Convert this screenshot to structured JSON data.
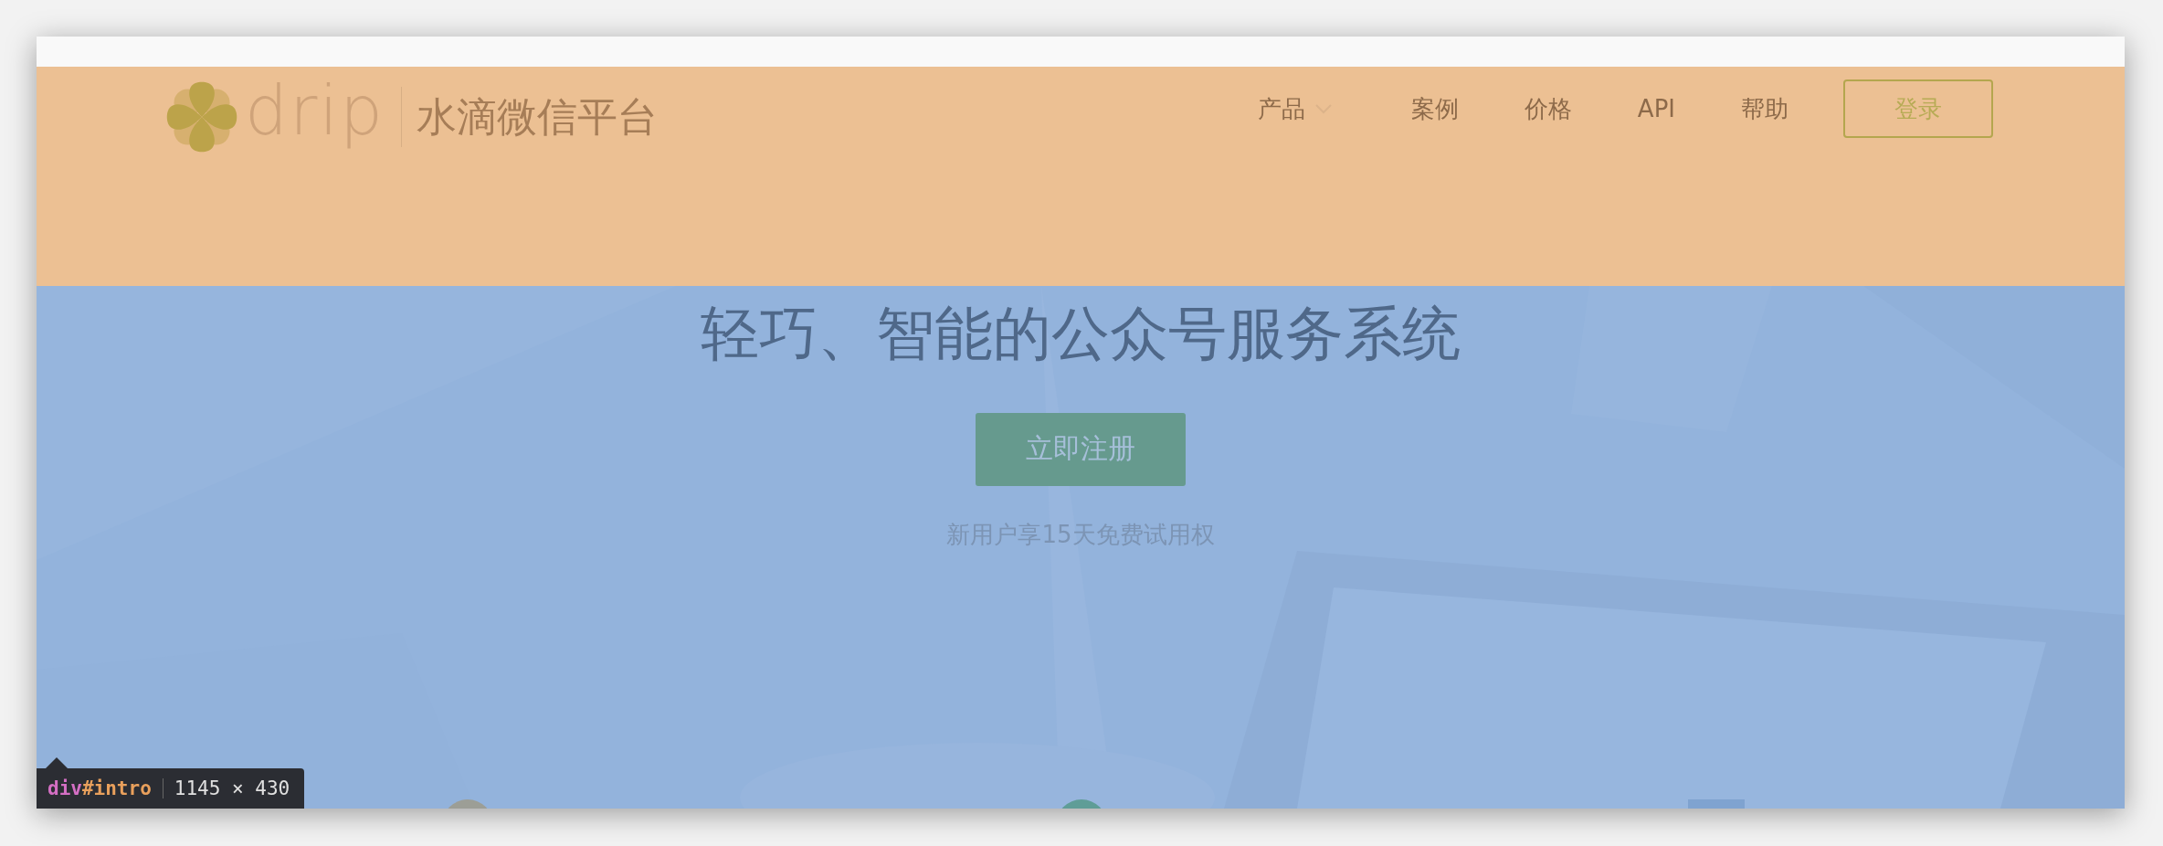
{
  "header": {
    "logo_text": "drip",
    "brand": "水滴微信平台",
    "nav": [
      {
        "label": "产品",
        "kind": "dropdown"
      },
      {
        "label": "案例",
        "kind": "link"
      },
      {
        "label": "价格",
        "kind": "link"
      },
      {
        "label": "API",
        "kind": "link"
      },
      {
        "label": "帮助",
        "kind": "link"
      }
    ],
    "login_button": "登录"
  },
  "hero": {
    "headline": "轻巧、智能的公众号服务系统",
    "cta_button": "立即注册",
    "note": "新用户享15天免费试用权"
  },
  "inspector_tooltip": {
    "tag": "div",
    "id": "#intro",
    "size": "1145 × 430"
  }
}
